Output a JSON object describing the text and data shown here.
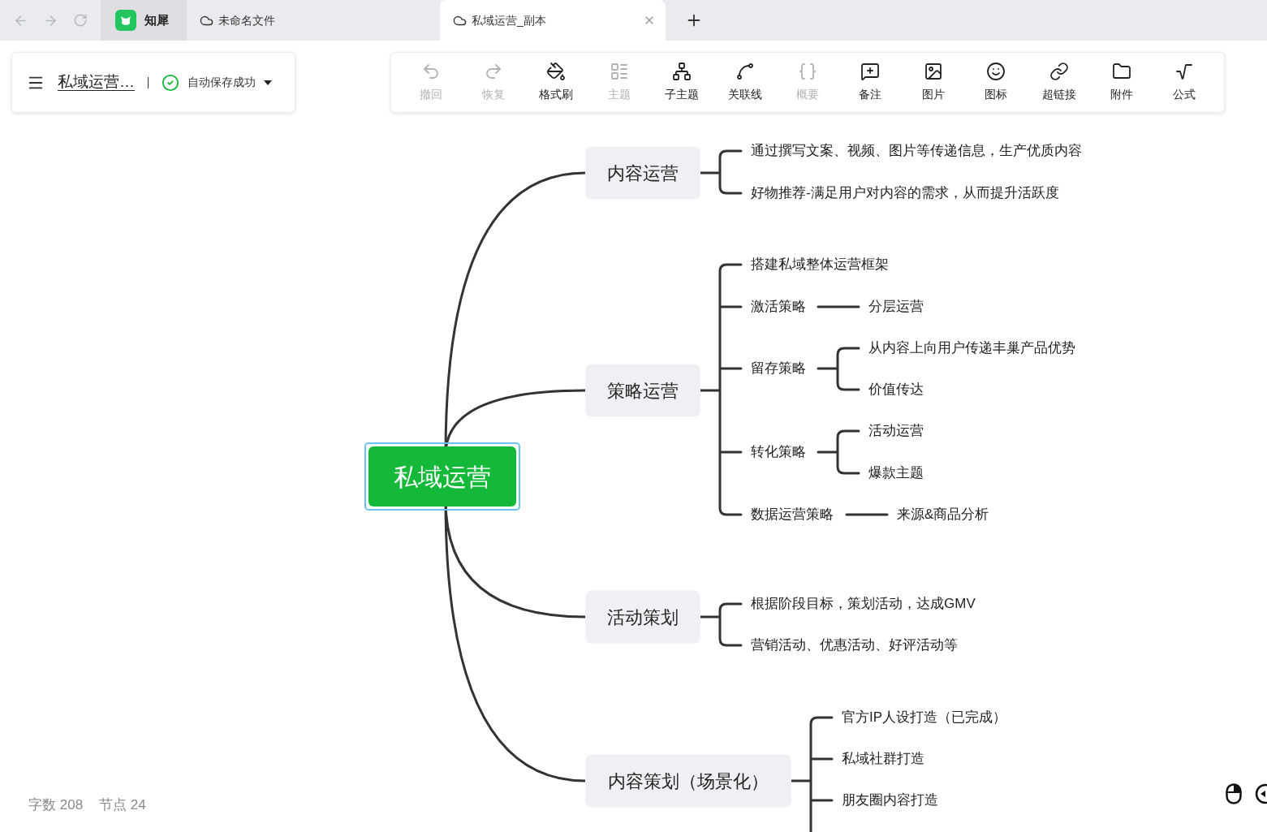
{
  "browser": {
    "tabs": [
      {
        "kind": "app",
        "label": "知犀",
        "selected": false
      },
      {
        "kind": "file",
        "label": "未命名文件",
        "selected": false
      },
      {
        "kind": "file",
        "label": "私域运营_副本",
        "selected": true
      }
    ]
  },
  "doc_panel": {
    "title": "私域运营…",
    "status": "自动保存成功"
  },
  "toolbar": [
    {
      "label": "撤回",
      "disabled": true
    },
    {
      "label": "恢复",
      "disabled": true
    },
    {
      "label": "格式刷",
      "disabled": false
    },
    {
      "label": "主题",
      "disabled": true
    },
    {
      "label": "子主题",
      "disabled": false
    },
    {
      "label": "关联线",
      "disabled": false
    },
    {
      "label": "概要",
      "disabled": true
    },
    {
      "label": "备注",
      "disabled": false
    },
    {
      "label": "图片",
      "disabled": false
    },
    {
      "label": "图标",
      "disabled": false
    },
    {
      "label": "超链接",
      "disabled": false
    },
    {
      "label": "附件",
      "disabled": false
    },
    {
      "label": "公式",
      "disabled": false
    }
  ],
  "mindmap": {
    "root": {
      "label": "私域运营",
      "selected": true,
      "children": [
        {
          "label": "内容运营",
          "continues": false,
          "children": [
            {
              "label": "通过撰写文案、视频、图片等传递信息，生产优质内容"
            },
            {
              "label": "好物推荐-满足用户对内容的需求，从而提升活跃度"
            }
          ]
        },
        {
          "label": "策略运营",
          "continues": false,
          "children": [
            {
              "label": "搭建私域整体运营框架"
            },
            {
              "label": "激活策略",
              "children": [
                {
                  "label": "分层运营"
                }
              ]
            },
            {
              "label": "留存策略",
              "children": [
                {
                  "label": "从内容上向用户传递丰巢产品优势"
                },
                {
                  "label": "价值传达"
                }
              ]
            },
            {
              "label": "转化策略",
              "children": [
                {
                  "label": "活动运营"
                },
                {
                  "label": "爆款主题"
                }
              ]
            },
            {
              "label": "数据运营策略",
              "children": [
                {
                  "label": "来源&商品分析"
                }
              ]
            }
          ]
        },
        {
          "label": "活动策划",
          "continues": false,
          "children": [
            {
              "label": "根据阶段目标，策划活动，达成GMV"
            },
            {
              "label": "营销活动、优惠活动、好评活动等"
            }
          ]
        },
        {
          "label": "内容策划（场景化）",
          "continues": true,
          "children": [
            {
              "label": "官方IP人设打造（已完成）"
            },
            {
              "label": "私域社群打造"
            },
            {
              "label": "朋友圈内容打造"
            }
          ]
        }
      ]
    }
  },
  "status_bar": {
    "words": "字数 208",
    "nodes": "节点 24"
  }
}
